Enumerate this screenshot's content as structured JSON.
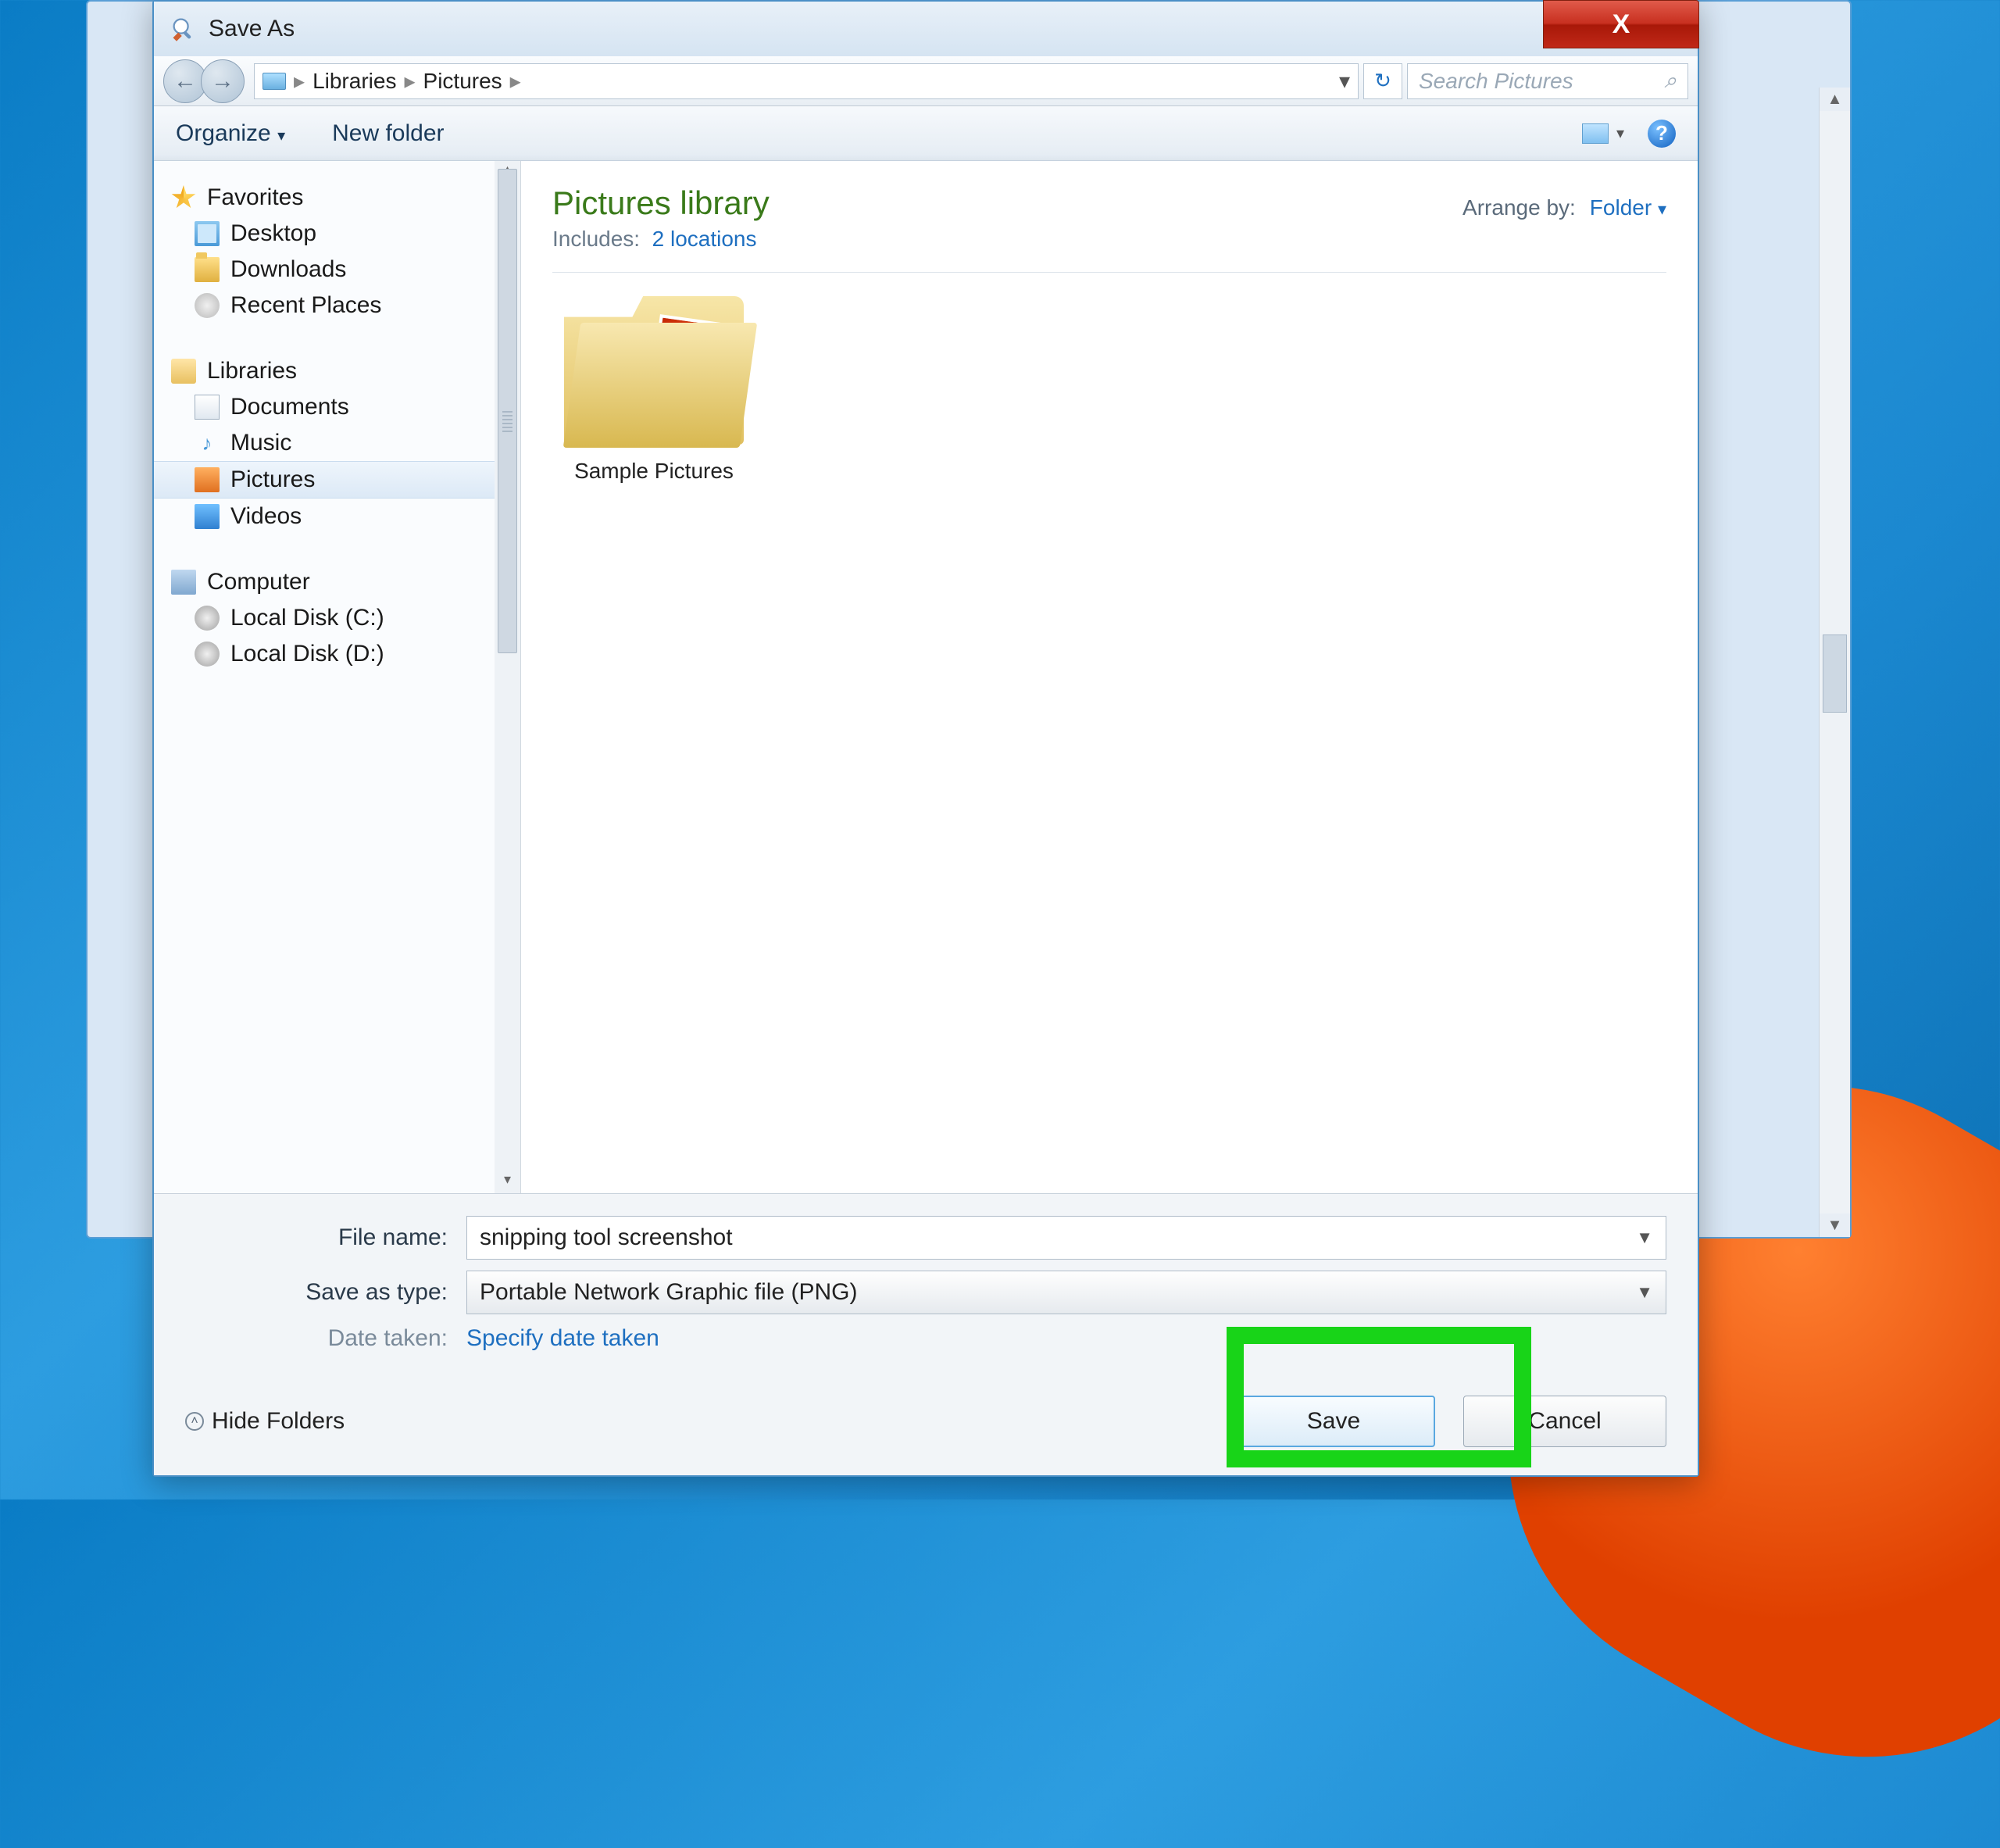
{
  "titlebar": {
    "title": "Save As",
    "close": "X"
  },
  "breadcrumb": {
    "items": [
      "Libraries",
      "Pictures"
    ]
  },
  "search": {
    "placeholder": "Search Pictures"
  },
  "toolbar": {
    "organize": "Organize",
    "newfolder": "New folder"
  },
  "sidebar": {
    "favorites": {
      "label": "Favorites",
      "items": [
        "Desktop",
        "Downloads",
        "Recent Places"
      ]
    },
    "libraries": {
      "label": "Libraries",
      "items": [
        "Documents",
        "Music",
        "Pictures",
        "Videos"
      ]
    },
    "computer": {
      "label": "Computer",
      "items": [
        "Local Disk (C:)",
        "Local Disk (D:)"
      ]
    }
  },
  "main": {
    "title": "Pictures library",
    "includes_label": "Includes:",
    "includes_link": "2 locations",
    "arrange_label": "Arrange by:",
    "arrange_value": "Folder",
    "items": [
      {
        "name": "Sample Pictures"
      }
    ]
  },
  "bottom": {
    "filename_label": "File name:",
    "filename_value": "snipping tool screenshot",
    "type_label": "Save as type:",
    "type_value": "Portable Network Graphic file (PNG)",
    "date_label": "Date taken:",
    "date_link": "Specify date taken"
  },
  "footer": {
    "hide": "Hide Folders",
    "save": "Save",
    "cancel": "Cancel"
  }
}
